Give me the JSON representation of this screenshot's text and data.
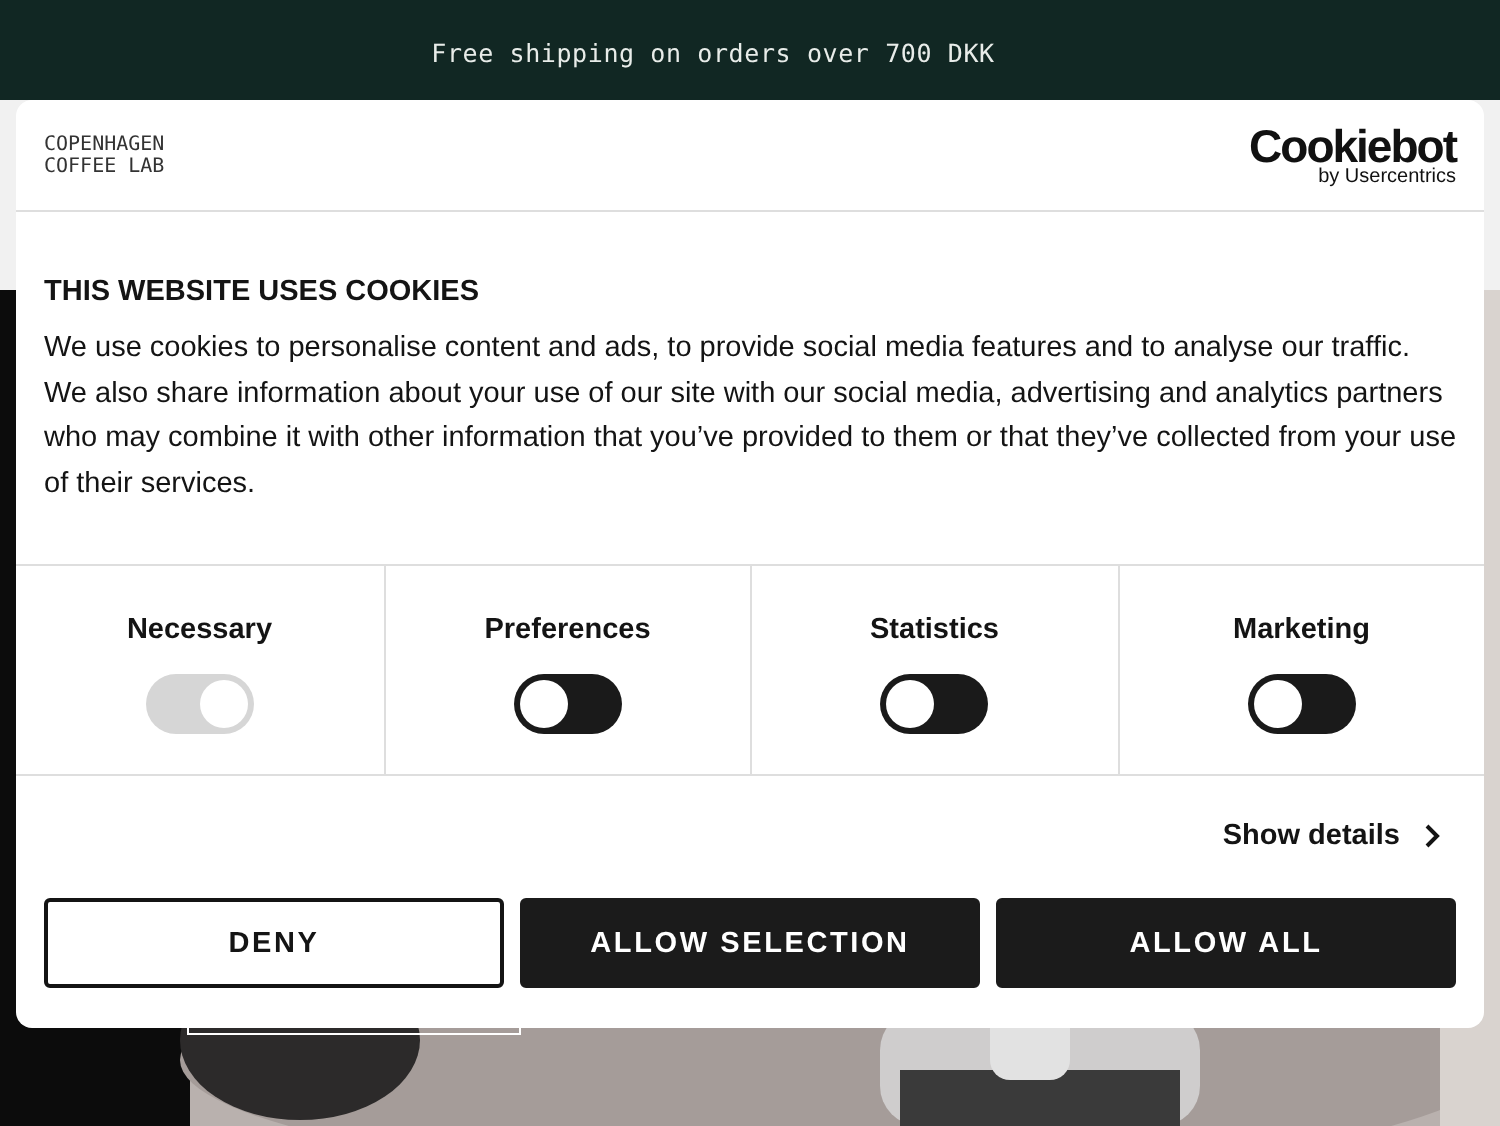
{
  "announcement_bar": {
    "text": "Free shipping on orders over 700 DKK"
  },
  "cookie_dialog": {
    "brand_logo": [
      "COPENHAGEN",
      "COFFEE LAB"
    ],
    "provider_logo": {
      "name": "Cookiebot",
      "byline": "by Usercentrics"
    },
    "title": "THIS WEBSITE USES COOKIES",
    "body": "We use cookies to personalise content and ads, to provide social media features and to analyse our traffic. We also share information about your use of our site with our social media, advertising and analytics partners who may combine it with other information that you’ve provided to them or that they’ve collected from your use of their services.",
    "categories": [
      {
        "label": "Necessary",
        "checked": true,
        "disabled": true
      },
      {
        "label": "Preferences",
        "checked": false,
        "disabled": false
      },
      {
        "label": "Statistics",
        "checked": false,
        "disabled": false
      },
      {
        "label": "Marketing",
        "checked": false,
        "disabled": false
      }
    ],
    "details_link": "Show details",
    "buttons": [
      {
        "label": "DENY",
        "kind": "outline"
      },
      {
        "label": "ALLOW SELECTION",
        "kind": "filled"
      },
      {
        "label": "ALLOW ALL",
        "kind": "filled"
      }
    ]
  }
}
